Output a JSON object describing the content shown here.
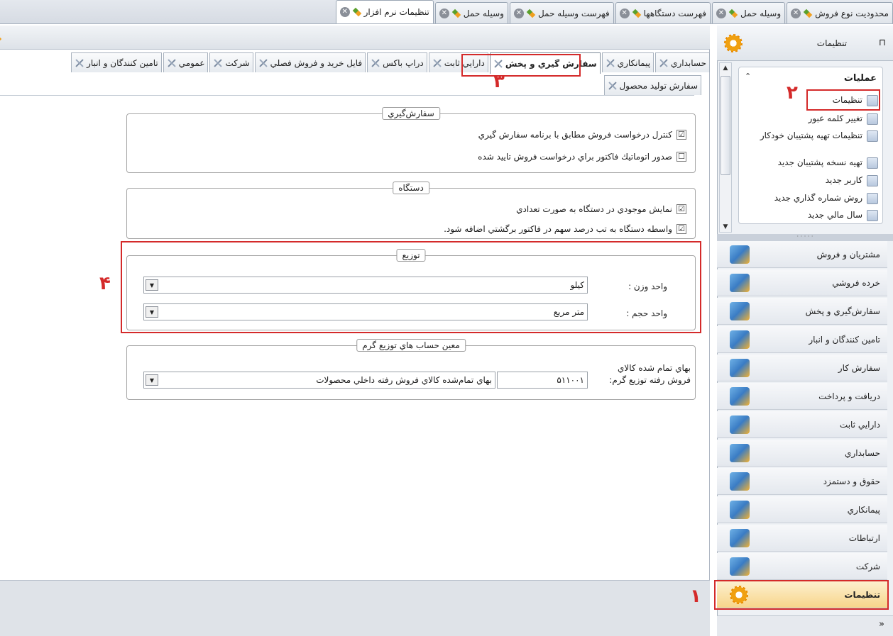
{
  "doc_tabs": [
    {
      "label": "محدوديت نوع فروش",
      "active": false
    },
    {
      "label": "وسيله حمل",
      "active": false
    },
    {
      "label": "فهرست دستگاهها",
      "active": false
    },
    {
      "label": "فهرست وسيله حمل",
      "active": false
    },
    {
      "label": "وسيله حمل",
      "active": false
    },
    {
      "label": "تنظيمات نرم افزار",
      "active": true
    }
  ],
  "settings_tabs_row1": [
    {
      "label": "حسابداري",
      "active": false
    },
    {
      "label": "پيمانكاري",
      "active": false
    },
    {
      "label": "سفارش گيري و پخش",
      "active": true
    },
    {
      "label": "دارايي ثابت",
      "active": false
    },
    {
      "label": "دراپ باكس",
      "active": false
    },
    {
      "label": "فايل خريد و فروش فصلي",
      "active": false
    },
    {
      "label": "شركت",
      "active": false
    },
    {
      "label": "عمومي",
      "active": false
    },
    {
      "label": "تامين كنندگان و انبار",
      "active": false
    }
  ],
  "settings_tabs_row2": [
    {
      "label": "سفارش توليد محصول"
    }
  ],
  "groups": {
    "ordering": {
      "title": "سفارش‌گيري",
      "options": [
        {
          "label": "كنترل درخواست فروش مطابق با برنامه سفارش گيري",
          "checked": true,
          "mark": "☑"
        },
        {
          "label": "صدور اتوماتيك فاكتور براي درخواست فروش تاييد شده",
          "checked": false,
          "mark": "☐"
        }
      ]
    },
    "device": {
      "title": "دستگاه",
      "options": [
        {
          "label": "نمايش موجودي در دستگاه به صورت تعدادي",
          "checked": true,
          "mark": "☑"
        },
        {
          "label": "واسطه دستگاه به تب درصد سهم در فاكتور برگشتي اضافه شود.",
          "checked": true,
          "mark": "☑"
        }
      ]
    },
    "distribution": {
      "title": "توزيع",
      "weight_label": "واحد وزن :",
      "weight_value": "كيلو",
      "volume_label": "واحد حجم :",
      "volume_value": "متر مربع"
    },
    "accounts": {
      "title": "معين حساب هاي توزيع گرم",
      "field_label_line1": "بهاي تمام شده كالاي",
      "field_label_line2": "فروش رفته توزيع گرم:",
      "account_code": "۵۱۱۰۰۱",
      "account_name": "بهاي تمام‌شده كالاي فروش رفته داخلي محصولات"
    }
  },
  "annotations": {
    "one": "۱",
    "two": "۲",
    "three": "۳",
    "four": "۴"
  },
  "sidebar": {
    "title": "تنظيمات",
    "pin": "⊓",
    "ops_title": "عمليات",
    "ops_collapse": "⌃",
    "ops": [
      {
        "label": "تنظيمات"
      },
      {
        "label": "تغيير كلمه عبور"
      },
      {
        "label": "تنظيمات تهيه پشتيبان خودكار"
      },
      {
        "label": "تهيه نسخه پشتيبان جديد"
      },
      {
        "label": "كاربر جديد"
      },
      {
        "label": "روش شماره گذاري جديد"
      },
      {
        "label": "سال مالي جديد"
      }
    ],
    "modules": [
      {
        "label": "مشتريان و فروش"
      },
      {
        "label": "خرده فروشي"
      },
      {
        "label": "سفارش‌گيري و پخش"
      },
      {
        "label": "تامين كنندگان و انبار"
      },
      {
        "label": "سفارش كار"
      },
      {
        "label": "دريافت و پرداخت"
      },
      {
        "label": "دارايي ثابت"
      },
      {
        "label": "حسابداري"
      },
      {
        "label": "حقوق و دستمزد"
      },
      {
        "label": "پيمانكاري"
      },
      {
        "label": "ارتباطات"
      },
      {
        "label": "شركت"
      },
      {
        "label": "تنظيمات"
      }
    ],
    "more": "»"
  },
  "colors": {
    "annotation": "#d42a2a",
    "accent": "#f0a010"
  }
}
